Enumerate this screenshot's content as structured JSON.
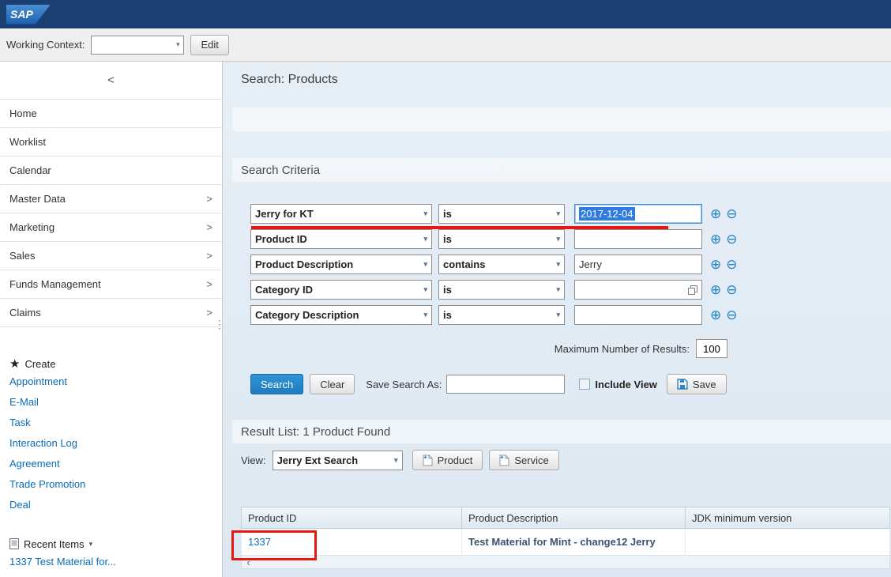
{
  "header": {
    "brand": "SAP"
  },
  "context_bar": {
    "label": "Working Context:",
    "value": "",
    "edit_button": "Edit"
  },
  "icons": {
    "chevron_down": "▾",
    "nav_chevron": ">",
    "collapse": "<",
    "plus": "⊕",
    "minus": "⊖",
    "create_star": "★",
    "recent_toggle": "▾",
    "scroll_left": "‹",
    "splitter": "⋮"
  },
  "sidebar": {
    "nav_items": [
      {
        "label": "Home"
      },
      {
        "label": "Worklist"
      },
      {
        "label": "Calendar"
      },
      {
        "label": "Master Data",
        "expandable": true
      },
      {
        "label": "Marketing",
        "expandable": true
      },
      {
        "label": "Sales",
        "expandable": true
      },
      {
        "label": "Funds Management",
        "expandable": true
      },
      {
        "label": "Claims",
        "expandable": true
      }
    ],
    "create": {
      "title": "Create",
      "links": [
        "Appointment",
        "E-Mail",
        "Task",
        "Interaction Log",
        "Agreement",
        "Trade Promotion",
        "Deal"
      ]
    },
    "recent": {
      "title": "Recent Items",
      "links": [
        "1337 Test Material for..."
      ]
    }
  },
  "main": {
    "page_title": "Search: Products",
    "search": {
      "title": "Search Criteria",
      "rows": [
        {
          "field": "Jerry for KT",
          "operator": "is",
          "value": "2017-12-04"
        },
        {
          "field": "Product ID",
          "operator": "is",
          "value": ""
        },
        {
          "field": "Product Description",
          "operator": "contains",
          "value": "Jerry"
        },
        {
          "field": "Category ID",
          "operator": "is",
          "value": ""
        },
        {
          "field": "Category Description",
          "operator": "is",
          "value": ""
        }
      ],
      "max_results_label": "Maximum Number of Results:",
      "max_results_value": "100",
      "buttons": {
        "search": "Search",
        "clear": "Clear",
        "save": "Save"
      },
      "save_search_label": "Save Search As:",
      "save_search_value": "",
      "include_view_label": "Include View"
    },
    "results": {
      "title": "Result List: 1 Product Found",
      "view_label": "View:",
      "view_value": "Jerry Ext Search",
      "buttons": {
        "product": "Product",
        "service": "Service"
      },
      "table": {
        "columns": [
          "Product ID",
          "Product Description",
          "JDK minimum version"
        ],
        "rows": [
          {
            "product_id": "1337",
            "description": "Test Material for Mint - change12 Jerry",
            "jdk_minimum_version": ""
          }
        ]
      }
    }
  },
  "annotations": {
    "color": "#e8170f"
  }
}
